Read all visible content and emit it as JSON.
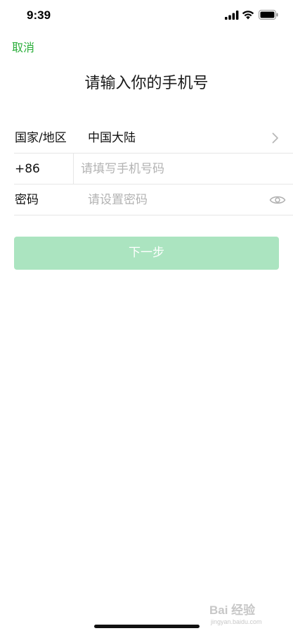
{
  "status_bar": {
    "time": "9:39"
  },
  "header": {
    "cancel_label": "取消",
    "title": "请输入你的手机号"
  },
  "form": {
    "country": {
      "label": "国家/地区",
      "value": "中国大陆"
    },
    "phone": {
      "code": "+86",
      "placeholder": "请填写手机号码",
      "value": ""
    },
    "password": {
      "label": "密码",
      "placeholder": "请设置密码",
      "value": ""
    }
  },
  "actions": {
    "next_label": "下一步"
  },
  "watermark": {
    "brand": "Bai 经验",
    "url": "jingyan.baidu.com"
  },
  "colors": {
    "accent_green": "#2aae3a",
    "button_disabled": "#abe4c0",
    "placeholder": "#b3b3b3",
    "divider": "#e6e6e6"
  },
  "icons": {
    "signal": "cellular-signal-icon",
    "wifi": "wifi-icon",
    "battery": "battery-icon",
    "chevron": "chevron-right-icon",
    "eye": "eye-icon"
  }
}
